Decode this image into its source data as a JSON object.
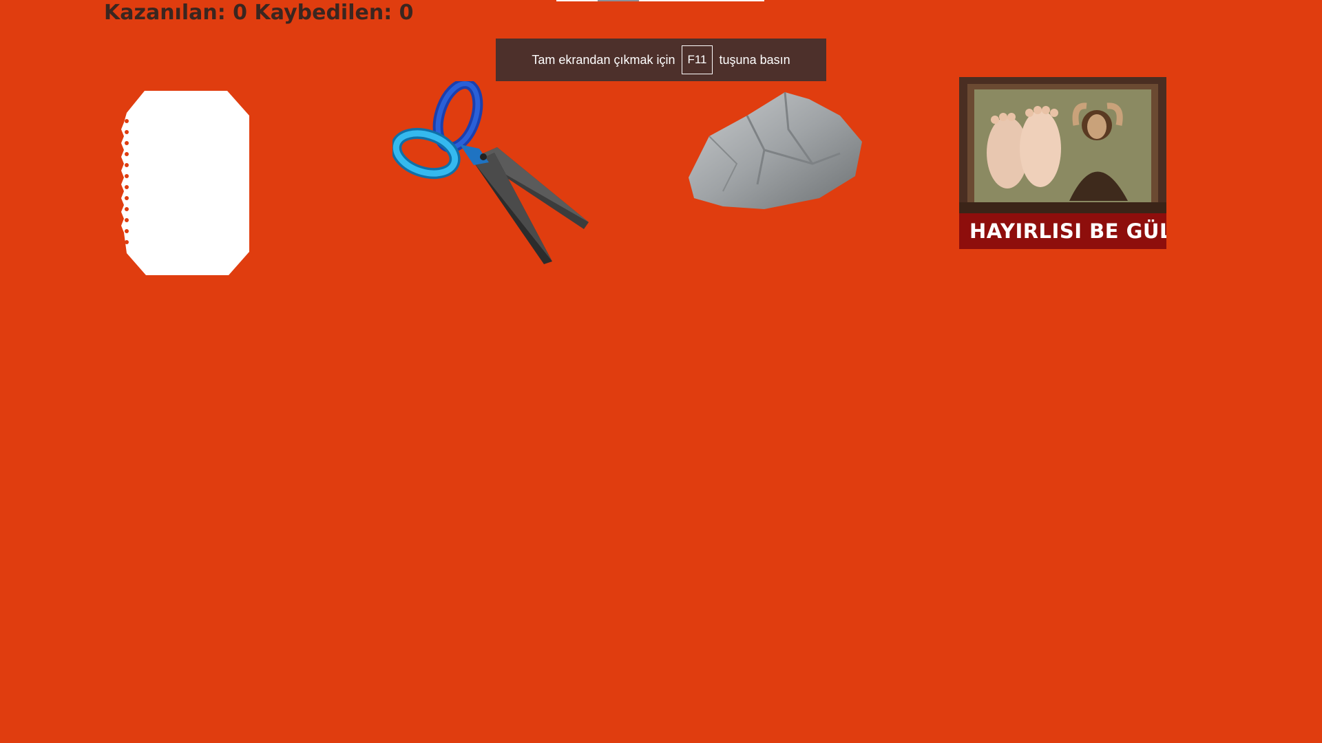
{
  "score": {
    "won_label": "Kazanılan:",
    "won_value": "0",
    "lost_label": "Kaybedilen:",
    "lost_value": "0"
  },
  "fullscreen_banner": {
    "prefix": "Tam ekrandan çıkmak için",
    "key": "F11",
    "suffix": "tuşuna basın"
  },
  "choices": [
    {
      "id": "paper",
      "icon": "paper-icon"
    },
    {
      "id": "scissors",
      "icon": "scissors-icon"
    },
    {
      "id": "rock",
      "icon": "rock-icon"
    }
  ],
  "result": {
    "caption": "HAYIRLISI BE GÜLÜM",
    "image": "mona-lisa-feet-meme-image"
  },
  "colors": {
    "background": "#e03d0f",
    "banner": "#4d302b",
    "caption_bar": "#8e0e0c",
    "score_text": "#3a2620"
  }
}
